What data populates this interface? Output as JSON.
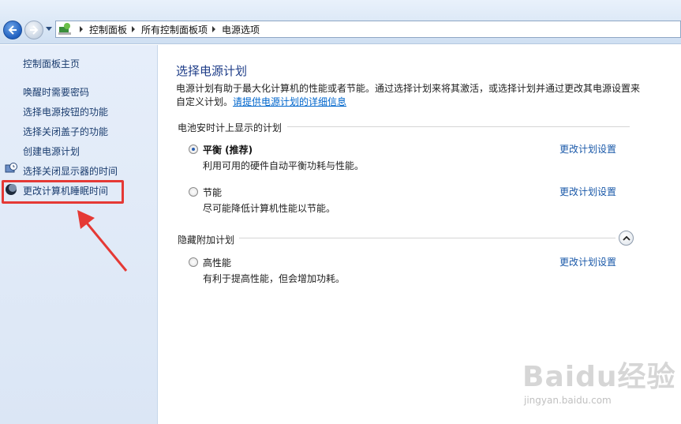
{
  "breadcrumb": {
    "items": [
      "控制面板",
      "所有控制面板项",
      "电源选项"
    ]
  },
  "leftnav": {
    "home": "控制面板主页",
    "items": [
      "唤醒时需要密码",
      "选择电源按钮的功能",
      "选择关闭盖子的功能",
      "创建电源计划",
      "选择关闭显示器的时间",
      "更改计算机睡眠时间"
    ]
  },
  "main": {
    "title": "选择电源计划",
    "intro": "电源计划有助于最大化计算机的性能或者节能。通过选择计划来将其激活，或选择计划并通过更改其电源设置来自定义计划。",
    "intro_link": "请提供电源计划的详细信息",
    "group1_label": "电池安时计上显示的计划",
    "group2_label": "隐藏附加计划",
    "plans": [
      {
        "name": "平衡 (推荐)",
        "desc": "利用可用的硬件自动平衡功耗与性能。",
        "link": "更改计划设置",
        "selected": true
      },
      {
        "name": "节能",
        "desc": "尽可能降低计算机性能以节能。",
        "link": "更改计划设置",
        "selected": false
      },
      {
        "name": "高性能",
        "desc": "有利于提高性能，但会增加功耗。",
        "link": "更改计划设置",
        "selected": false
      }
    ]
  },
  "watermark": {
    "text": "Baidu经验",
    "sub": "jingyan.baidu.com"
  },
  "colors": {
    "highlight": "#e53935",
    "link": "#1a59a9",
    "title": "#1e3d88"
  }
}
